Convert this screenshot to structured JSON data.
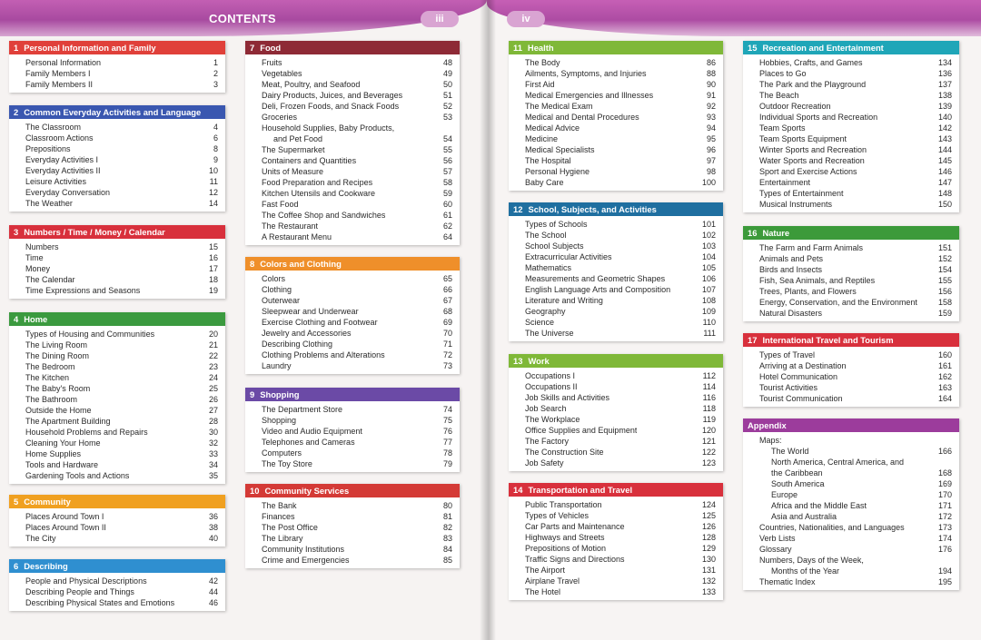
{
  "header": {
    "title": "CONTENTS",
    "left_page": "iii",
    "right_page": "iv"
  },
  "sections": [
    {
      "num": "1",
      "title": "Personal Information and Family",
      "color": "#e0403a",
      "entries": [
        {
          "label": "Personal Information",
          "page": "1"
        },
        {
          "label": "Family Members I",
          "page": "2"
        },
        {
          "label": "Family Members II",
          "page": "3"
        }
      ]
    },
    {
      "num": "2",
      "title": "Common Everyday Activities and Language",
      "color": "#3a57b0",
      "entries": [
        {
          "label": "The Classroom",
          "page": "4"
        },
        {
          "label": "Classroom Actions",
          "page": "6"
        },
        {
          "label": "Prepositions",
          "page": "8"
        },
        {
          "label": "Everyday Activities I",
          "page": "9"
        },
        {
          "label": "Everyday Activities II",
          "page": "10"
        },
        {
          "label": "Leisure Activities",
          "page": "11"
        },
        {
          "label": "Everyday Conversation",
          "page": "12"
        },
        {
          "label": "The Weather",
          "page": "14"
        }
      ]
    },
    {
      "num": "3",
      "title": "Numbers / Time / Money / Calendar",
      "color": "#d8303c",
      "entries": [
        {
          "label": "Numbers",
          "page": "15"
        },
        {
          "label": "Time",
          "page": "16"
        },
        {
          "label": "Money",
          "page": "17"
        },
        {
          "label": "The Calendar",
          "page": "18"
        },
        {
          "label": "Time Expressions and Seasons",
          "page": "19"
        }
      ]
    },
    {
      "num": "4",
      "title": "Home",
      "color": "#3b9a3f",
      "entries": [
        {
          "label": "Types of Housing and Communities",
          "page": "20"
        },
        {
          "label": "The Living Room",
          "page": "21"
        },
        {
          "label": "The Dining Room",
          "page": "22"
        },
        {
          "label": "The Bedroom",
          "page": "23"
        },
        {
          "label": "The Kitchen",
          "page": "24"
        },
        {
          "label": "The Baby's Room",
          "page": "25"
        },
        {
          "label": "The Bathroom",
          "page": "26"
        },
        {
          "label": "Outside the Home",
          "page": "27"
        },
        {
          "label": "The Apartment Building",
          "page": "28"
        },
        {
          "label": "Household Problems and Repairs",
          "page": "30"
        },
        {
          "label": "Cleaning Your Home",
          "page": "32"
        },
        {
          "label": "Home Supplies",
          "page": "33"
        },
        {
          "label": "Tools and Hardware",
          "page": "34"
        },
        {
          "label": "Gardening Tools and Actions",
          "page": "35"
        }
      ]
    },
    {
      "num": "5",
      "title": "Community",
      "color": "#f0a020",
      "entries": [
        {
          "label": "Places Around Town I",
          "page": "36"
        },
        {
          "label": "Places Around Town II",
          "page": "38"
        },
        {
          "label": "The City",
          "page": "40"
        }
      ]
    },
    {
      "num": "6",
      "title": "Describing",
      "color": "#2f8fd0",
      "entries": [
        {
          "label": "People and Physical Descriptions",
          "page": "42"
        },
        {
          "label": "Describing People and Things",
          "page": "44"
        },
        {
          "label": "Describing Physical States and Emotions",
          "page": "46"
        }
      ]
    },
    {
      "num": "7",
      "title": "Food",
      "color": "#8e2a36",
      "entries": [
        {
          "label": "Fruits",
          "page": "48"
        },
        {
          "label": "Vegetables",
          "page": "49"
        },
        {
          "label": "Meat, Poultry, and Seafood",
          "page": "50"
        },
        {
          "label": "Dairy Products, Juices, and Beverages",
          "page": "51"
        },
        {
          "label": "Deli, Frozen Foods, and Snack Foods",
          "page": "52"
        },
        {
          "label": "Groceries",
          "page": "53"
        },
        {
          "label": "Household Supplies, Baby Products,",
          "page": ""
        },
        {
          "label": "and Pet Food",
          "page": "54",
          "indent": true
        },
        {
          "label": "The Supermarket",
          "page": "55"
        },
        {
          "label": "Containers and Quantities",
          "page": "56"
        },
        {
          "label": "Units of Measure",
          "page": "57"
        },
        {
          "label": "Food Preparation and Recipes",
          "page": "58"
        },
        {
          "label": "Kitchen Utensils and Cookware",
          "page": "59"
        },
        {
          "label": "Fast Food",
          "page": "60"
        },
        {
          "label": "The Coffee Shop and Sandwiches",
          "page": "61"
        },
        {
          "label": "The Restaurant",
          "page": "62"
        },
        {
          "label": "A Restaurant Menu",
          "page": "64"
        }
      ]
    },
    {
      "num": "8",
      "title": "Colors and Clothing",
      "color": "#ef8f2a",
      "entries": [
        {
          "label": "Colors",
          "page": "65"
        },
        {
          "label": "Clothing",
          "page": "66"
        },
        {
          "label": "Outerwear",
          "page": "67"
        },
        {
          "label": "Sleepwear and Underwear",
          "page": "68"
        },
        {
          "label": "Exercise Clothing and Footwear",
          "page": "69"
        },
        {
          "label": "Jewelry and Accessories",
          "page": "70"
        },
        {
          "label": "Describing Clothing",
          "page": "71"
        },
        {
          "label": "Clothing Problems and Alterations",
          "page": "72"
        },
        {
          "label": "Laundry",
          "page": "73"
        }
      ]
    },
    {
      "num": "9",
      "title": "Shopping",
      "color": "#6b4aa6",
      "entries": [
        {
          "label": "The Department Store",
          "page": "74"
        },
        {
          "label": "Shopping",
          "page": "75"
        },
        {
          "label": "Video and Audio Equipment",
          "page": "76"
        },
        {
          "label": "Telephones and Cameras",
          "page": "77"
        },
        {
          "label": "Computers",
          "page": "78"
        },
        {
          "label": "The Toy Store",
          "page": "79"
        }
      ]
    },
    {
      "num": "10",
      "title": "Community Services",
      "color": "#d43a36",
      "entries": [
        {
          "label": "The Bank",
          "page": "80"
        },
        {
          "label": "Finances",
          "page": "81"
        },
        {
          "label": "The Post Office",
          "page": "82"
        },
        {
          "label": "The Library",
          "page": "83"
        },
        {
          "label": "Community Institutions",
          "page": "84"
        },
        {
          "label": "Crime and Emergencies",
          "page": "85"
        }
      ]
    },
    {
      "num": "11",
      "title": "Health",
      "color": "#7fb838",
      "entries": [
        {
          "label": "The Body",
          "page": "86"
        },
        {
          "label": "Ailments, Symptoms, and Injuries",
          "page": "88"
        },
        {
          "label": "First Aid",
          "page": "90"
        },
        {
          "label": "Medical Emergencies and Illnesses",
          "page": "91"
        },
        {
          "label": "The Medical Exam",
          "page": "92"
        },
        {
          "label": "Medical and Dental Procedures",
          "page": "93"
        },
        {
          "label": "Medical Advice",
          "page": "94"
        },
        {
          "label": "Medicine",
          "page": "95"
        },
        {
          "label": "Medical Specialists",
          "page": "96"
        },
        {
          "label": "The Hospital",
          "page": "97"
        },
        {
          "label": "Personal Hygiene",
          "page": "98"
        },
        {
          "label": "Baby Care",
          "page": "100"
        }
      ]
    },
    {
      "num": "12",
      "title": "School, Subjects, and Activities",
      "color": "#1f6fa0",
      "entries": [
        {
          "label": "Types of Schools",
          "page": "101"
        },
        {
          "label": "The School",
          "page": "102"
        },
        {
          "label": "School Subjects",
          "page": "103"
        },
        {
          "label": "Extracurricular Activities",
          "page": "104"
        },
        {
          "label": "Mathematics",
          "page": "105"
        },
        {
          "label": "Measurements and Geometric Shapes",
          "page": "106"
        },
        {
          "label": "English Language Arts and Composition",
          "page": "107"
        },
        {
          "label": "Literature and Writing",
          "page": "108"
        },
        {
          "label": "Geography",
          "page": "109"
        },
        {
          "label": "Science",
          "page": "110"
        },
        {
          "label": "The Universe",
          "page": "111"
        }
      ]
    },
    {
      "num": "13",
      "title": "Work",
      "color": "#7fb838",
      "entries": [
        {
          "label": "Occupations I",
          "page": "112"
        },
        {
          "label": "Occupations II",
          "page": "114"
        },
        {
          "label": "Job Skills and Activities",
          "page": "116"
        },
        {
          "label": "Job Search",
          "page": "118"
        },
        {
          "label": "The Workplace",
          "page": "119"
        },
        {
          "label": "Office Supplies and Equipment",
          "page": "120"
        },
        {
          "label": "The Factory",
          "page": "121"
        },
        {
          "label": "The Construction Site",
          "page": "122"
        },
        {
          "label": "Job Safety",
          "page": "123"
        }
      ]
    },
    {
      "num": "14",
      "title": "Transportation and Travel",
      "color": "#d8303c",
      "entries": [
        {
          "label": "Public Transportation",
          "page": "124"
        },
        {
          "label": "Types of Vehicles",
          "page": "125"
        },
        {
          "label": "Car Parts and Maintenance",
          "page": "126"
        },
        {
          "label": "Highways and Streets",
          "page": "128"
        },
        {
          "label": "Prepositions of Motion",
          "page": "129"
        },
        {
          "label": "Traffic Signs and Directions",
          "page": "130"
        },
        {
          "label": "The Airport",
          "page": "131"
        },
        {
          "label": "Airplane Travel",
          "page": "132"
        },
        {
          "label": "The Hotel",
          "page": "133"
        }
      ]
    },
    {
      "num": "15",
      "title": "Recreation and Entertainment",
      "color": "#1fa6b8",
      "entries": [
        {
          "label": "Hobbies, Crafts, and Games",
          "page": "134"
        },
        {
          "label": "Places to Go",
          "page": "136"
        },
        {
          "label": "The Park and the Playground",
          "page": "137"
        },
        {
          "label": "The Beach",
          "page": "138"
        },
        {
          "label": "Outdoor Recreation",
          "page": "139"
        },
        {
          "label": "Individual Sports and Recreation",
          "page": "140"
        },
        {
          "label": "Team Sports",
          "page": "142"
        },
        {
          "label": "Team Sports Equipment",
          "page": "143"
        },
        {
          "label": "Winter Sports and Recreation",
          "page": "144"
        },
        {
          "label": "Water Sports and Recreation",
          "page": "145"
        },
        {
          "label": "Sport and Exercise Actions",
          "page": "146"
        },
        {
          "label": "Entertainment",
          "page": "147"
        },
        {
          "label": "Types of Entertainment",
          "page": "148"
        },
        {
          "label": "Musical Instruments",
          "page": "150"
        }
      ]
    },
    {
      "num": "16",
      "title": "Nature",
      "color": "#3c9a3a",
      "entries": [
        {
          "label": "The Farm and Farm Animals",
          "page": "151"
        },
        {
          "label": "Animals and Pets",
          "page": "152"
        },
        {
          "label": "Birds and Insects",
          "page": "154"
        },
        {
          "label": "Fish, Sea Animals, and Reptiles",
          "page": "155"
        },
        {
          "label": "Trees, Plants, and Flowers",
          "page": "156"
        },
        {
          "label": "Energy, Conservation, and the Environment",
          "page": "158"
        },
        {
          "label": "Natural Disasters",
          "page": "159"
        }
      ]
    },
    {
      "num": "17",
      "title": "International Travel and Tourism",
      "color": "#d8303c",
      "entries": [
        {
          "label": "Types of Travel",
          "page": "160"
        },
        {
          "label": "Arriving at a Destination",
          "page": "161"
        },
        {
          "label": "Hotel Communication",
          "page": "162"
        },
        {
          "label": "Tourist Activities",
          "page": "163"
        },
        {
          "label": "Tourist Communication",
          "page": "164"
        }
      ]
    },
    {
      "num": "",
      "title": "Appendix",
      "color": "#9c3c9c",
      "entries": [
        {
          "label": "Maps:",
          "page": ""
        },
        {
          "label": "The World",
          "page": "166",
          "indent": true
        },
        {
          "label": "North America, Central America, and",
          "page": "",
          "indent": true
        },
        {
          "label": "   the Caribbean",
          "page": "168",
          "indent": true
        },
        {
          "label": "South America",
          "page": "169",
          "indent": true
        },
        {
          "label": "Europe",
          "page": "170",
          "indent": true
        },
        {
          "label": "Africa and the Middle East",
          "page": "171",
          "indent": true
        },
        {
          "label": "Asia and Australia",
          "page": "172",
          "indent": true
        },
        {
          "label": "Countries, Nationalities, and Languages",
          "page": "173"
        },
        {
          "label": "Verb Lists",
          "page": "174"
        },
        {
          "label": "Glossary",
          "page": "176"
        },
        {
          "label": "Numbers, Days of the Week,",
          "page": ""
        },
        {
          "label": "Months of the Year",
          "page": "194",
          "indent": true
        },
        {
          "label": "Thematic Index",
          "page": "195"
        }
      ]
    }
  ]
}
